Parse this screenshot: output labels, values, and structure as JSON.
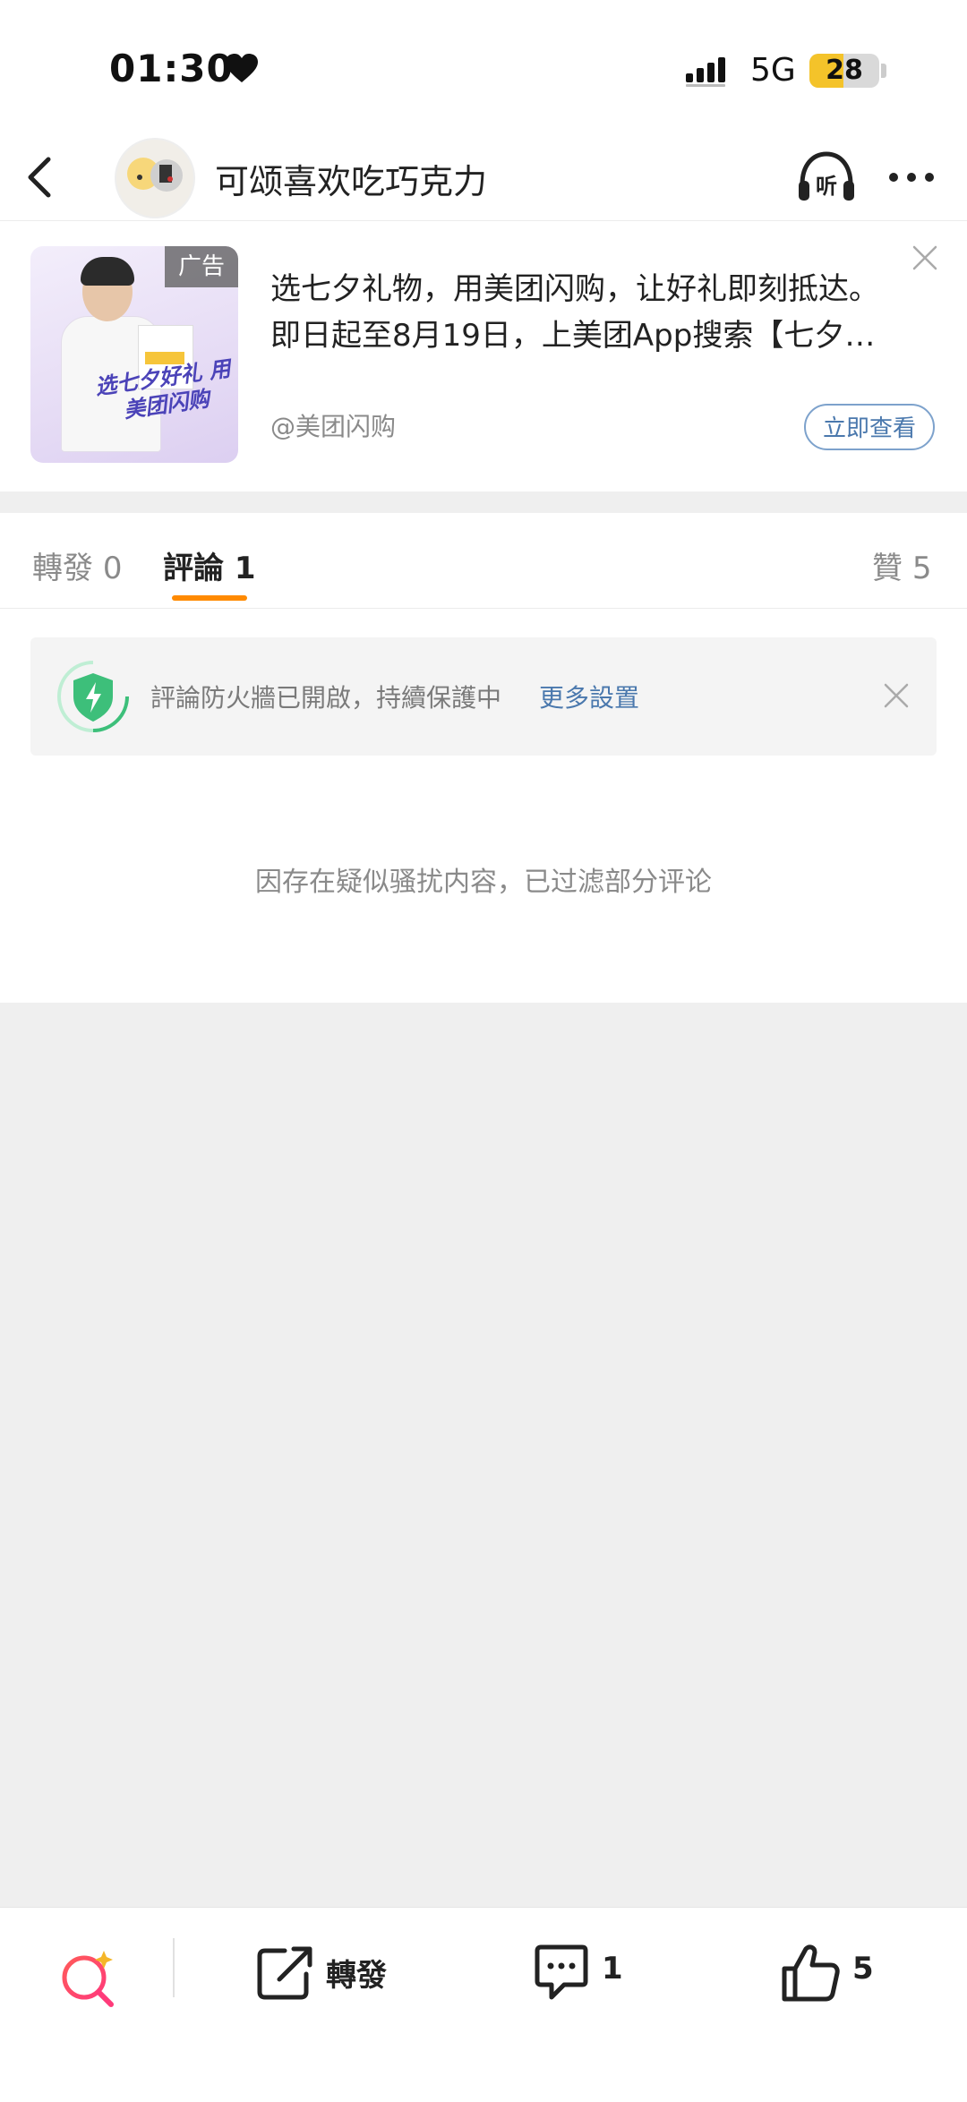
{
  "status_bar": {
    "time": "01:30",
    "network": "5G",
    "battery": "28",
    "icons": [
      "heart-icon",
      "signal-icon",
      "battery-icon"
    ]
  },
  "nav": {
    "title": "可颂喜欢吃巧克力",
    "icons": [
      "back-icon",
      "avatar",
      "listen-icon",
      "more-icon"
    ],
    "listen_glyph": "听"
  },
  "ad": {
    "tag": "广告",
    "line1": "选七夕礼物，用美团闪购，让好礼即刻抵达。",
    "line2": "即日起至8月19日，上美团App搜索【七夕…",
    "source": "@美团闪购",
    "button": "立即查看",
    "image_slogan": "选七夕好礼 用美团闪购",
    "image_brand": "美团闪购"
  },
  "tabs": {
    "repost": {
      "label": "轉發",
      "count": "0"
    },
    "comment": {
      "label": "評論",
      "count": "1"
    },
    "like": {
      "label": "贊",
      "count": "5"
    },
    "active": "comment",
    "accent": "#ff8a00"
  },
  "firewall": {
    "text": "評論防火牆已開啟，持續保護中",
    "link": "更多設置",
    "icon": "shield-bolt-icon"
  },
  "filtered_notice": "因存在疑似骚扰内容，已过滤部分评论",
  "bottom_bar": {
    "repost_label": "轉發",
    "comment_count": "1",
    "like_count": "5",
    "icons": [
      "ai-search-icon",
      "share-icon",
      "comment-icon",
      "like-icon"
    ]
  },
  "colors": {
    "link": "#4a78ad",
    "battery": "#f4c32a",
    "shield": "#3dbf7a"
  }
}
